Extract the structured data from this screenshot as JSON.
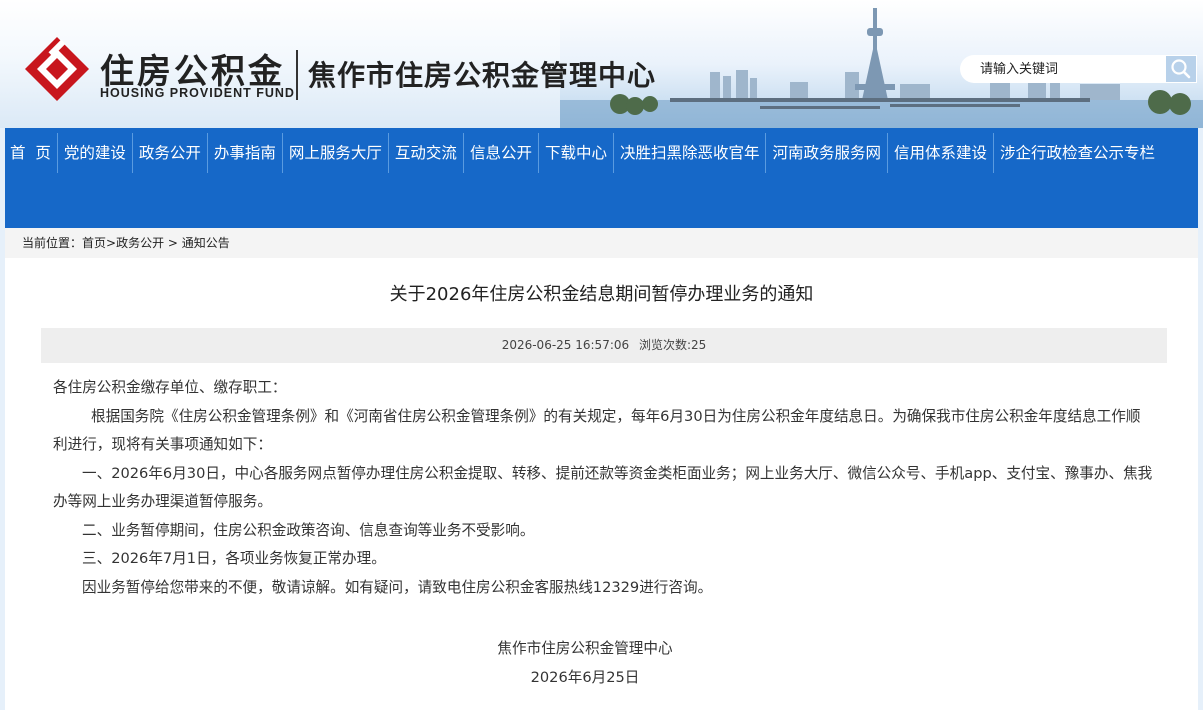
{
  "header": {
    "logo_cn": "住房公积金",
    "logo_en": "HOUSING PROVIDENT FUND",
    "org_name": "焦作市住房公积金管理中心"
  },
  "nav": {
    "items": [
      {
        "label": "首  页"
      },
      {
        "label": "党的建设"
      },
      {
        "label": "政务公开"
      },
      {
        "label": "办事指南"
      },
      {
        "label": "网上服务大厅"
      },
      {
        "label": "互动交流"
      },
      {
        "label": "信息公开"
      },
      {
        "label": "下载中心"
      },
      {
        "label": "决胜扫黑除恶收官年"
      },
      {
        "label": "河南政务服务网"
      },
      {
        "label": "信用体系建设"
      },
      {
        "label": "涉企行政检查公示专栏"
      }
    ],
    "search_placeholder": "请输入关键词"
  },
  "breadcrumb": {
    "prefix": "当前位置：",
    "items": [
      "首页",
      "政务公开",
      "通知公告"
    ],
    "sep1": ">",
    "sep2": " > "
  },
  "article": {
    "title": "关于2026年住房公积金结息期间暂停办理业务的通知",
    "date": "2026-06-25 16:57:06",
    "views": "浏览次数:25",
    "salutation": "各住房公积金缴存单位、缴存职工：",
    "paragraphs": [
      "根据国务院《住房公积金管理条例》和《河南省住房公积金管理条例》的有关规定，每年6月30日为住房公积金年度结息日。为确保我市住房公积金年度结息工作顺利进行，现将有关事项通知如下：",
      "一、2026年6月30日，中心各服务网点暂停办理住房公积金提取、转移、提前还款等资金类柜面业务；网上业务大厅、微信公众号、手机app、支付宝、豫事办、焦我办等网上业务办理渠道暂停服务。",
      "二、业务暂停期间，住房公积金政策咨询、信息查询等业务不受影响。",
      "三、2026年7月1日，各项业务恢复正常办理。",
      "因业务暂停给您带来的不便，敬请谅解。如有疑问，请致电住房公积金客服热线12329进行咨询。"
    ],
    "signature": "焦作市住房公积金管理中心",
    "sign_date": "2026年6月25日"
  },
  "colors": {
    "nav_bg": "#1668c8",
    "logo_red": "#c8161d"
  },
  "icons": {
    "logo": "housing-fund-logo-icon",
    "search": "search-icon"
  }
}
